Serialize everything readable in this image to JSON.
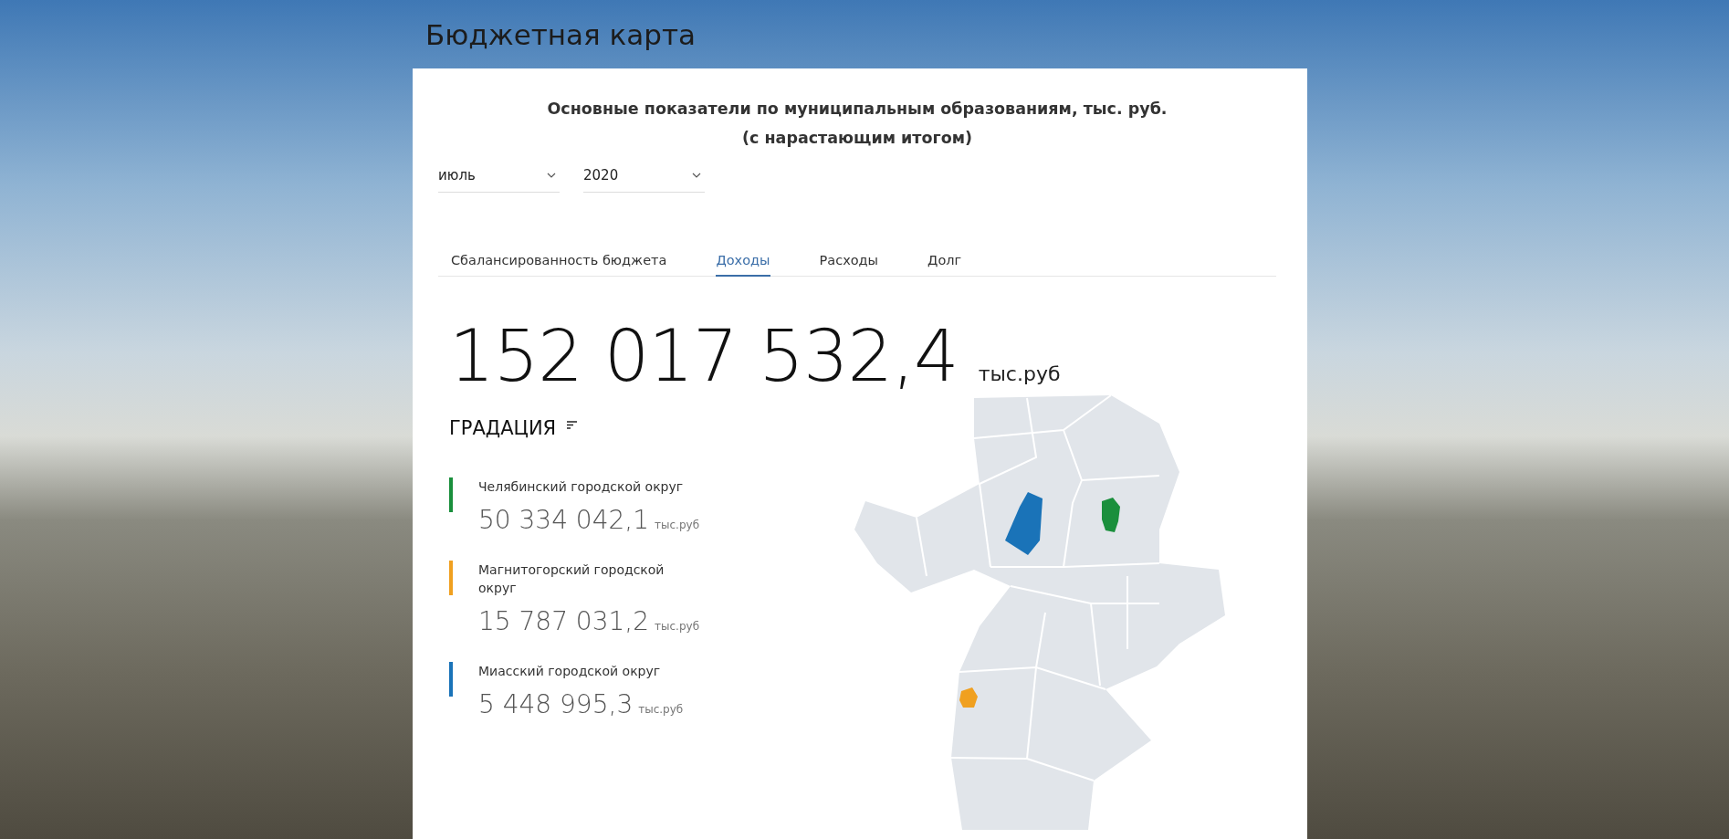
{
  "page_title": "Бюджетная карта",
  "card": {
    "heading_lines": [
      "Основные показатели по муниципальным образованиям, тыс. руб.",
      "(с нарастающим итогом)"
    ],
    "filters": [
      {
        "value": "июль"
      },
      {
        "value": "2020"
      }
    ],
    "tabs": [
      {
        "label": "Сбалансированность бюджета",
        "selected": false
      },
      {
        "label": "Доходы",
        "selected": true
      },
      {
        "label": "Расходы",
        "selected": false
      },
      {
        "label": "Долг",
        "selected": false
      }
    ],
    "total": {
      "value": "152 017 532,4",
      "unit": "тыс.руб"
    },
    "gradation": {
      "title": "ГРАДАЦИЯ"
    },
    "districts": [
      {
        "name": "Челябинский городской округ",
        "value": "50 334 042,1",
        "unit": "тыс.руб",
        "color": "#1a8f3c"
      },
      {
        "name": "Магнитогорский городской округ",
        "value": "15 787 031,2",
        "unit": "тыс.руб",
        "color": "#f0a020"
      },
      {
        "name": "Миасский городской округ",
        "value": "5 448 995,3",
        "unit": "тыс.руб",
        "color": "#1a73b8"
      }
    ]
  }
}
